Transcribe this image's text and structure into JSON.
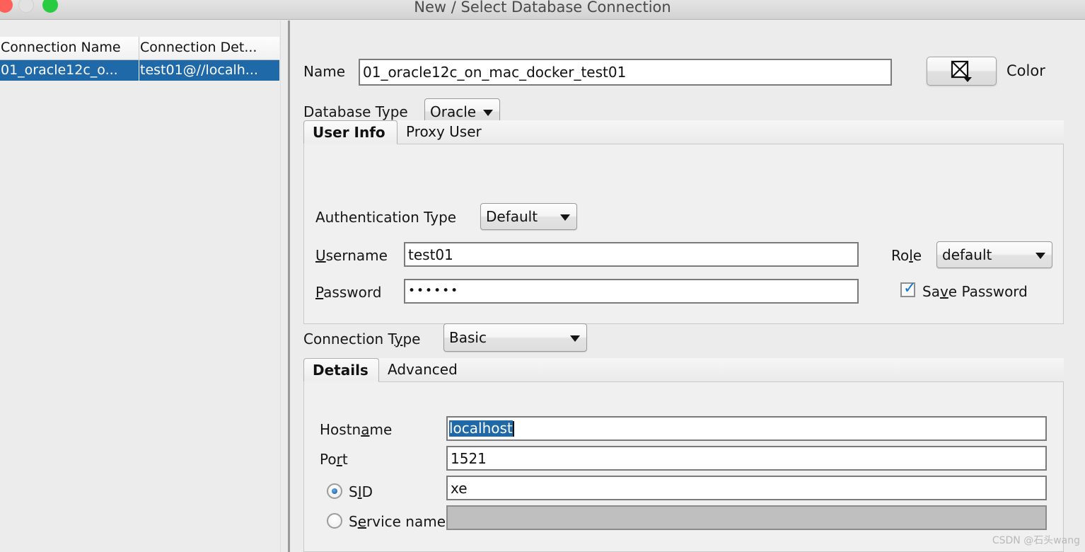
{
  "window": {
    "title": "New / Select Database Connection",
    "traffic_lights": [
      "close-button",
      "minimize-button",
      "zoom-button"
    ]
  },
  "connection_list": {
    "columns": [
      "Connection Name",
      "Connection Det..."
    ],
    "rows": [
      {
        "name": "01_oracle12c_o...",
        "details": "test01@//localh..."
      }
    ],
    "selected_row_index": 0,
    "selection_color": "#1f69a8"
  },
  "form": {
    "name_label": "Name",
    "name_value": "01_oracle12c_on_mac_docker_test01",
    "color_button_label": "Color",
    "color_button_icon": "no-color-swatch-icon",
    "database_type_label": "Database Type",
    "database_type_value": "Oracle"
  },
  "user_tabs": {
    "tabs": [
      {
        "label": "User Info",
        "active": true
      },
      {
        "label": "Proxy User",
        "active": false
      }
    ]
  },
  "user_info": {
    "auth_type_label": "Authentication Type",
    "auth_type_value": "Default",
    "username_label_pre": "",
    "username_label_mnemonic": "U",
    "username_label_post": "sername",
    "username_value": "test01",
    "password_label_mnemonic": "P",
    "password_label_post": "assword",
    "password_value": "••••••",
    "role_label_pre": "Ro",
    "role_label_mnemonic": "l",
    "role_label_post": "e",
    "role_value": "default",
    "save_password_pre": "Sa",
    "save_password_mnemonic": "v",
    "save_password_post": "e Password",
    "save_password_checked": true
  },
  "connection_type": {
    "label_pre": "Connection T",
    "label_mnemonic": "y",
    "label_post": "pe",
    "value": "Basic"
  },
  "detail_tabs": {
    "tabs": [
      {
        "label": "Details",
        "active": true
      },
      {
        "label": "Advanced",
        "active": false
      }
    ]
  },
  "details": {
    "hostname_label_pre": "Hostn",
    "hostname_label_mnemonic": "a",
    "hostname_label_post": "me",
    "hostname_value": "localhost",
    "hostname_selected": true,
    "port_label_pre": "Po",
    "port_label_mnemonic": "r",
    "port_label_post": "t",
    "port_value": "1521",
    "sid_label_pre": "S",
    "sid_label_mnemonic": "I",
    "sid_label_post": "D",
    "sid_value": "xe",
    "sid_selected": true,
    "service_name_label_pre": "S",
    "service_name_label_mnemonic": "e",
    "service_name_label_post": "rvice name",
    "service_name_value": "",
    "service_name_selected": false,
    "service_name_disabled": true
  },
  "watermark": {
    "text": "CSDN @石头wang"
  }
}
